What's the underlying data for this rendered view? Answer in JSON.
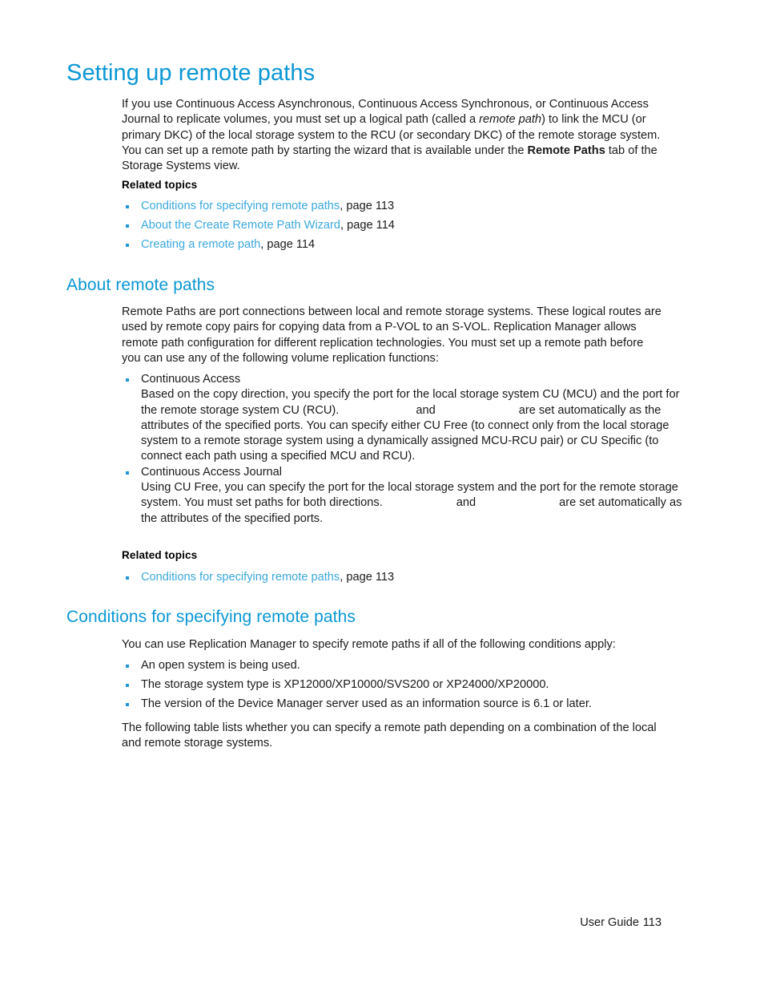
{
  "document": {
    "title": "Setting up remote paths",
    "colors": {
      "heading_blue": "#0b97d4",
      "link_blue": "#3ba8dd",
      "bullet_blue": "#2196d6",
      "body_text": "#1a1a1a",
      "background": "#ffffff"
    }
  },
  "intro": {
    "text_part1": "If you use Continuous Access Asynchronous, Continuous Access Synchronous, or Continuous Access Journal to replicate volumes, you must set up a logical path (called a ",
    "italic_term": "remote path",
    "text_part2": ") to link the MCU (or primary DKC) of the local storage system to the RCU (or secondary DKC) of the remote storage system. You can set up a remote path by starting the wizard that is available under the ",
    "bold_term": "Remote Paths",
    "text_part3": " tab of the Storage Systems view."
  },
  "related_topics_1": {
    "label": "Related topics",
    "items": [
      {
        "link": "Conditions for specifying remote paths",
        "pageref": ", page 113"
      },
      {
        "link": "About the Create Remote Path Wizard",
        "pageref": ", page 114"
      },
      {
        "link": "Creating a remote path",
        "pageref": ", page 114"
      }
    ]
  },
  "about_remote_paths": {
    "heading": "About remote paths",
    "paragraph": "Remote Paths are port connections between local and remote storage systems. These logical routes are used by remote copy pairs for copying data from a P-VOL to an S-VOL. Replication Manager allows remote path configuration for different replication technologies. You must set up a remote path before you can use any of the following volume replication functions:",
    "features": [
      {
        "term": "Continuous Access",
        "desc_part1": "Based on the copy direction, you specify the port for the local storage system CU (MCU) and the port for the remote storage system CU (RCU).",
        "desc_gap_join": "and",
        "desc_part2": "are set automatically as the attributes of the specified ports. You can specify either CU Free (to connect only from the local storage system to a remote storage system using a dynamically assigned MCU-RCU pair) or CU Specific (to connect each path using a specified MCU and RCU)."
      },
      {
        "term": "Continuous Access Journal",
        "desc_part1": "Using CU Free, you can specify the port for the local storage system and the port for the remote storage system. You must set paths for both directions.",
        "desc_gap_join": "and",
        "desc_part2": "are set automatically as the attributes of the specified ports."
      }
    ]
  },
  "related_topics_2": {
    "label": "Related topics",
    "items": [
      {
        "link": "Conditions for specifying remote paths",
        "pageref": ", page 113"
      }
    ]
  },
  "conditions": {
    "heading": "Conditions for specifying remote paths",
    "intro": "You can use Replication Manager to specify remote paths if all of the following conditions apply:",
    "items": [
      "An open system is being used.",
      "The storage system type is XP12000/XP10000/SVS200 or XP24000/XP20000.",
      "The version of the Device Manager server used as an information source is 6.1 or later."
    ],
    "outro": "The following table lists whether you can specify a remote path depending on a combination of the local and remote storage systems."
  },
  "footer": {
    "guide_label": "User Guide",
    "page_number": "113"
  }
}
